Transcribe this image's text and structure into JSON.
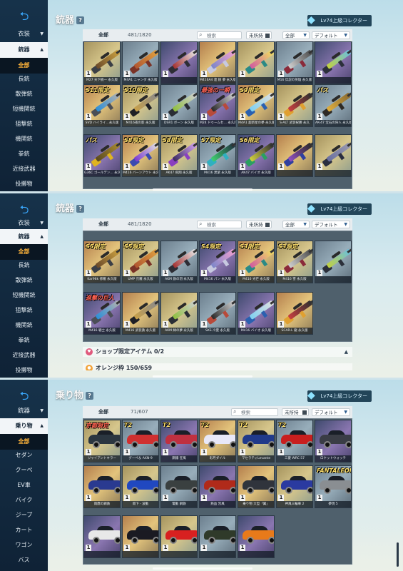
{
  "screens": [
    {
      "title": "銃器",
      "help": "?",
      "collector": "Lv74上級コレクター",
      "sidebar": {
        "top": "衣装",
        "active_category": "銃器",
        "subitems": [
          "全部",
          "長銃",
          "散弾銃",
          "短機関銃",
          "狙撃銃",
          "機関銃",
          "拳銃",
          "近接武器",
          "投擲物"
        ]
      },
      "toolbar": {
        "all": "全部",
        "count": "481/1820",
        "search_placeholder": "検索",
        "unowned": "未所持",
        "filter": "全部",
        "sort": "デフォルト"
      },
      "rows": [
        [
          "M27 天下統一 永久版",
          "M4A1 ニャンダ 永久版",
          "",
          "M416A4 連 鋭 夢 永久版",
          "",
          "M16 伝説の英雄 永久版",
          ""
        ],
        [
          "SVD ハイライ…永久版",
          "M416夜の影 永久版",
          "DSR1 ボーン 永久版",
          "M24 ドゥームセ… 永久版",
          "M4A1 超新星の夢 永久版",
          "S-ALT 武装祝勝 永久",
          "AK-47 宝石の狩人 永久版"
        ],
        [
          "G36C ゴールデン… 永久版",
          "M416 バーンアウト 永久版",
          "AK47 飛翔 永久版",
          "M416 黒紫 永久版",
          "AK47 バイオ 永久版",
          "",
          ""
        ]
      ],
      "tags": [
        "S11限定",
        "S10限定",
        "",
        "最強の一瞬",
        "S9限定",
        "",
        "パス",
        "パス",
        "S8限定",
        "S8限定",
        "S7限定",
        "S6限定"
      ]
    },
    {
      "title": "銃器",
      "help": "?",
      "collector": "Lv74上級コレクター",
      "sidebar": {
        "top": "衣装",
        "active_category": "銃器",
        "subitems": [
          "全部",
          "長銃",
          "散弾銃",
          "短機関銃",
          "狙撃銃",
          "機関銃",
          "拳銃",
          "近接武器",
          "投擲物"
        ]
      },
      "toolbar": {
        "all": "全部",
        "count": "481/1820",
        "search_placeholder": "検索",
        "unowned": "未所持",
        "filter": "全部",
        "sort": "デフォルト"
      },
      "rows": [
        [
          "Kar98k ブラックホール 永久版",
          "AK-47 吸血鬼の主 永久版",
          "M416 グローブプロ 永久版",
          "",
          "",
          "",
          ""
        ],
        [
          "Kar98k 修羅 永久版",
          "UMP 刃羅 永久版",
          "AKM 鉄の羽 永久版",
          "M416 パン 永久版",
          "M416 光芒 永久版",
          "M416 雪 永久版",
          ""
        ],
        [
          "M416 戦士 永久版",
          "M416 武装鉄 永久版",
          "AKM 緑の夢 永久版",
          "SKS 冷夏 永久版",
          "M416 バイオ 永久版",
          "SCAR-L 龍 永久版",
          ""
        ]
      ],
      "tags": [
        "S5限定",
        "S5限定",
        "",
        "S4限定",
        "S3限定",
        "S3限定",
        "進撃の巨人"
      ],
      "sections": [
        {
          "icon": "♥",
          "label": "ショップ限定アイテム 0/2"
        },
        {
          "icon": "●",
          "label": "オレンジ枠 150/659"
        }
      ]
    },
    {
      "title": "乗り物",
      "help": "?",
      "collector": "Lv74上級コレクター",
      "sidebar": {
        "top": "銃器",
        "active_category": "乗り物",
        "subitems": [
          "全部",
          "セダン",
          "クーペ",
          "EV車",
          "バイク",
          "ジープ",
          "カート",
          "ワゴン",
          "バス"
        ]
      },
      "toolbar": {
        "all": "全部",
        "count": "71/607",
        "search_placeholder": "検索",
        "unowned": "未所持",
        "sort": "デフォルト"
      },
      "rows": [
        [
          "ジャイアントキラー",
          "グーペ＆ AXN-9",
          "鋼鐵 狂風",
          "彩月ダイル",
          "マセラティLevante",
          "三菱 WRC 57",
          "ロケットウォッチ"
        ],
        [
          "雨鷹の鋼鉄",
          "雨下 - 波動",
          "電動 鋼鉄",
          "熱血 烈風",
          "乗り物 大型「翼」",
          "神風三輪車 2",
          "夢現 5"
        ],
        [
          "",
          "",
          "",
          "",
          ""
        ]
      ],
      "tags": [
        "京都限定",
        "T2",
        "T2",
        "T2",
        "T2",
        "T2",
        "FANTALEON"
      ]
    }
  ]
}
